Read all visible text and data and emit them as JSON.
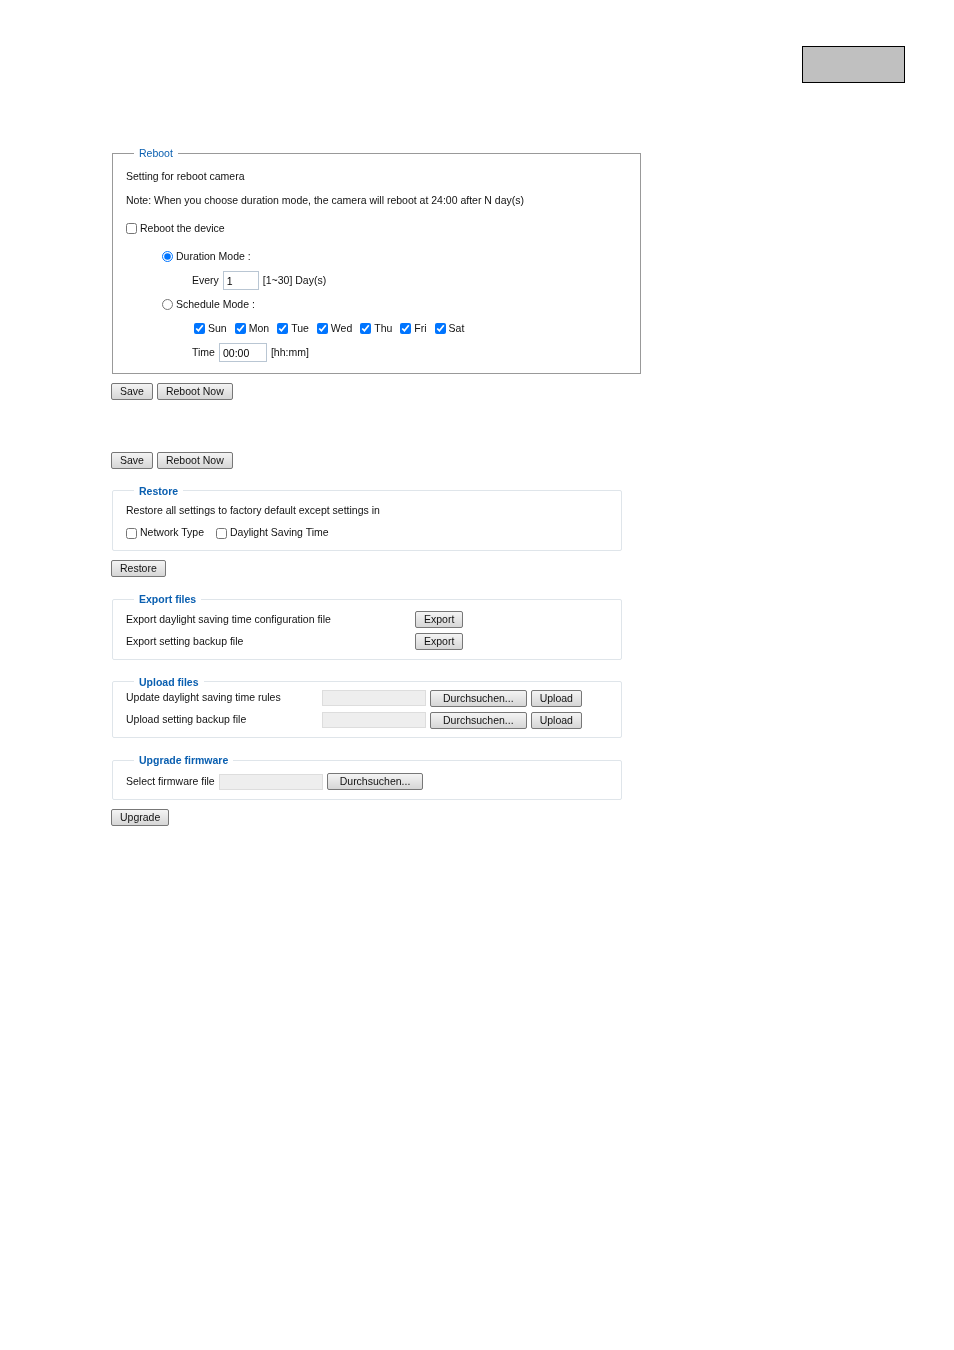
{
  "reboot": {
    "legend": "Reboot",
    "description": "Setting for reboot camera",
    "note": "Note: When you choose duration mode, the camera will reboot at 24:00 after N day(s)",
    "reboot_device": {
      "label": "Reboot the device",
      "checked": false
    },
    "modes": [
      {
        "label": "Duration Mode :",
        "selected": true
      },
      {
        "label": "Schedule Mode :",
        "selected": false
      }
    ],
    "every": {
      "label": "Every",
      "value": "1",
      "hint": "[1~30] Day(s)"
    },
    "days": [
      {
        "label": "Sun",
        "checked": true
      },
      {
        "label": "Mon",
        "checked": true
      },
      {
        "label": "Tue",
        "checked": true
      },
      {
        "label": "Wed",
        "checked": true
      },
      {
        "label": "Thu",
        "checked": true
      },
      {
        "label": "Fri",
        "checked": true
      },
      {
        "label": "Sat",
        "checked": true
      }
    ],
    "time": {
      "label": "Time",
      "value": "00:00",
      "hint": "[hh:mm]"
    },
    "buttons": [
      "Save",
      "Reboot Now"
    ]
  },
  "buttons_2": [
    "Save",
    "Reboot Now"
  ],
  "restore": {
    "legend": "Restore",
    "description": "Restore all settings to factory default except settings in",
    "options": [
      {
        "label": "Network Type",
        "checked": false
      },
      {
        "label": "Daylight Saving Time",
        "checked": false
      }
    ],
    "button": "Restore"
  },
  "export_files": {
    "legend": "Export files",
    "rows": [
      {
        "label": "Export daylight saving time configuration file",
        "button": "Export"
      },
      {
        "label": "Export setting backup file",
        "button": "Export"
      }
    ]
  },
  "upload_files": {
    "legend": "Upload files",
    "rows": [
      {
        "label": "Update daylight saving time rules",
        "browse": "Durchsuchen...",
        "button": "Upload"
      },
      {
        "label": "Upload setting backup file",
        "browse": "Durchsuchen...",
        "button": "Upload"
      }
    ]
  },
  "upgrade_firmware": {
    "legend": "Upgrade firmware",
    "label": "Select firmware file",
    "browse": "Durchsuchen...",
    "button": "Upgrade"
  }
}
